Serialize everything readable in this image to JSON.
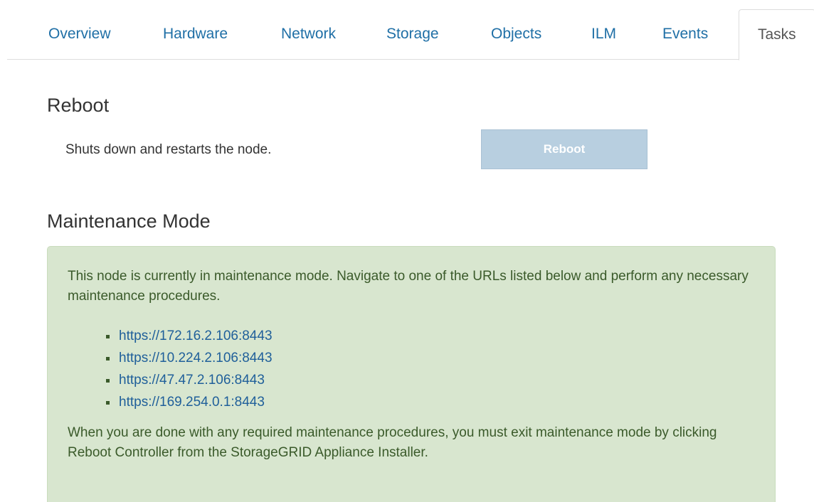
{
  "tabs": [
    {
      "label": "Overview",
      "active": false
    },
    {
      "label": "Hardware",
      "active": false
    },
    {
      "label": "Network",
      "active": false
    },
    {
      "label": "Storage",
      "active": false
    },
    {
      "label": "Objects",
      "active": false
    },
    {
      "label": "ILM",
      "active": false
    },
    {
      "label": "Events",
      "active": false
    },
    {
      "label": "Tasks",
      "active": true
    }
  ],
  "reboot": {
    "title": "Reboot",
    "description": "Shuts down and restarts the node.",
    "button_label": "Reboot",
    "button_state": "disabled"
  },
  "maintenance": {
    "title": "Maintenance Mode",
    "intro": "This node is currently in maintenance mode. Navigate to one of the URLs listed below and perform any necessary maintenance procedures.",
    "urls": [
      "https://172.16.2.106:8443",
      "https://10.224.2.106:8443",
      "https://47.47.2.106:8443",
      "https://169.254.0.1:8443"
    ],
    "outro": "When you are done with any required maintenance procedures, you must exit maintenance mode by clicking Reboot Controller from the StorageGRID Appliance Installer."
  },
  "colors": {
    "link": "#1f6fa6",
    "alert_background": "#d8e6cf",
    "alert_text": "#3a5a2a",
    "disabled_button": "#b8cfe0"
  }
}
